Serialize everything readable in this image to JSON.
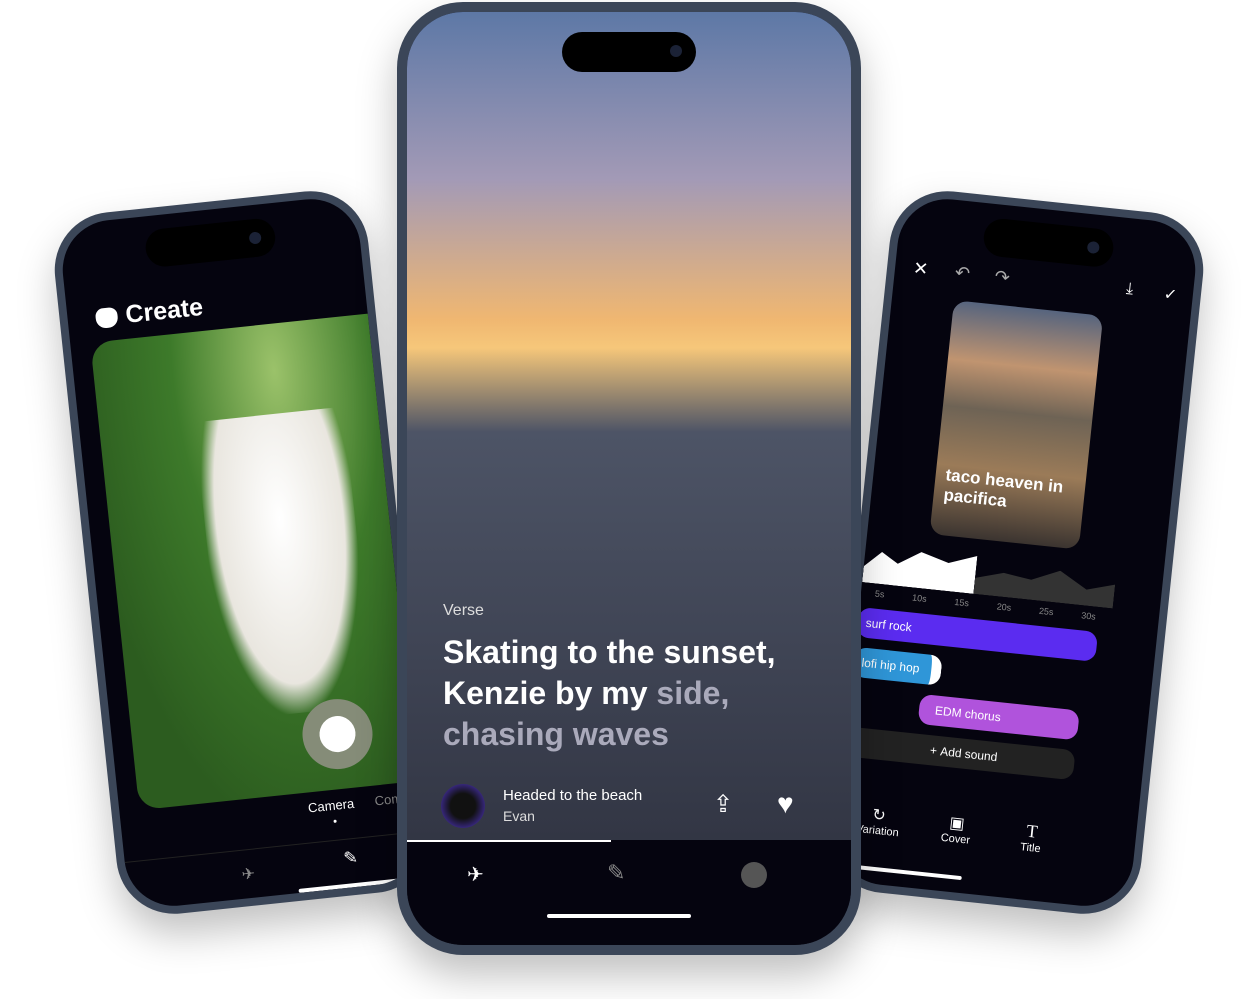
{
  "left": {
    "title": "Create",
    "modes": [
      "Camera",
      "Compose"
    ],
    "icons": [
      "telescope-icon",
      "compose-icon"
    ]
  },
  "center": {
    "section": "Verse",
    "lyric_line1": "Skating to the sunset,",
    "lyric_line2a": "Kenzie by my ",
    "lyric_line2b": "side,",
    "lyric_line3": "chasing waves",
    "song_title": "Headed to the beach",
    "author": "Evan",
    "progress": 0.46
  },
  "right": {
    "photo_caption": "taco heaven in pacifica",
    "ticks": [
      "5s",
      "10s",
      "15s",
      "20s",
      "25s",
      "30s"
    ],
    "tracks": [
      {
        "label": "surf rock",
        "color": "#5b2cf0"
      },
      {
        "label": "lofi hip hop",
        "color": "#2f96d8"
      },
      {
        "label": "EDM chorus",
        "color": "#b053dc"
      }
    ],
    "add_sound": "Add sound",
    "tools": [
      "Variation",
      "Cover",
      "Title"
    ]
  }
}
